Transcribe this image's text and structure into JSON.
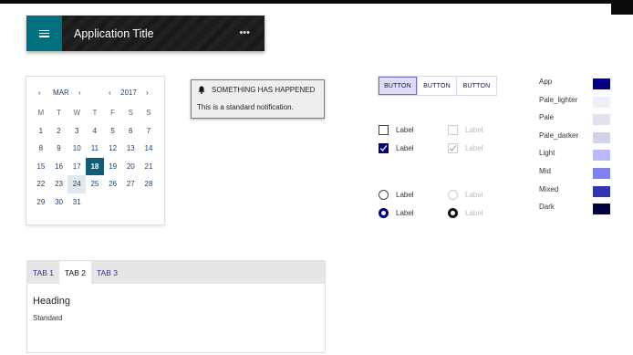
{
  "app_bar": {
    "title": "Application Title",
    "more": "•••"
  },
  "calendar": {
    "month": "MAR",
    "year": "2017",
    "prev": "‹",
    "next": "›",
    "weekdays": [
      "M",
      "T",
      "W",
      "T",
      "F",
      "S",
      "S"
    ],
    "weeks": [
      [
        "1",
        "2",
        "3",
        "4",
        "5",
        "6",
        "7"
      ],
      [
        "8",
        "9",
        "10",
        "11",
        "12",
        "13",
        "14"
      ],
      [
        "15",
        "16",
        "17",
        "18",
        "19",
        "20",
        "21"
      ],
      [
        "22",
        "23",
        "24",
        "25",
        "26",
        "27",
        "28"
      ],
      [
        "29",
        "30",
        "31",
        "",
        "",
        "",
        ""
      ]
    ],
    "selected_day": "18",
    "hover_day": "24"
  },
  "notification": {
    "title": "SOMETHING HAS HAPPENED",
    "body": "This is a standard notification."
  },
  "tabs": {
    "items": [
      "TAB 1",
      "TAB 2",
      "TAB 3"
    ],
    "active_index": 1,
    "heading": "Heading",
    "text": "Standard"
  },
  "button_group": {
    "buttons": [
      "BUTTON",
      "BUTTON",
      "BUTTON"
    ],
    "active_index": 0
  },
  "checkboxes": [
    {
      "label": "Label",
      "checked": false,
      "disabled": false
    },
    {
      "label": "Label",
      "checked": false,
      "disabled": true
    },
    {
      "label": "Label",
      "checked": true,
      "disabled": false
    },
    {
      "label": "Label",
      "checked": true,
      "disabled": true
    }
  ],
  "radios": [
    {
      "label": "Label",
      "checked": false,
      "disabled": false
    },
    {
      "label": "Label",
      "checked": false,
      "disabled": true
    },
    {
      "label": "Label",
      "checked": true,
      "disabled": false
    },
    {
      "label": "Label",
      "checked": true,
      "disabled": true
    }
  ],
  "swatches": [
    {
      "label": "App",
      "color": "#000080"
    },
    {
      "label": "Pale_lighter",
      "color": "#eeeef6"
    },
    {
      "label": "Pale",
      "color": "#e2e2ee"
    },
    {
      "label": "Pale_darker",
      "color": "#d3d3e8"
    },
    {
      "label": "Light",
      "color": "#b9b9f8"
    },
    {
      "label": "Mid",
      "color": "#8080f0"
    },
    {
      "label": "Mixed",
      "color": "#3333b8"
    },
    {
      "label": "Dark",
      "color": "#00003a"
    }
  ],
  "icons": {
    "menu": "menu-icon",
    "bell": "bell-icon",
    "check": "check-icon"
  }
}
